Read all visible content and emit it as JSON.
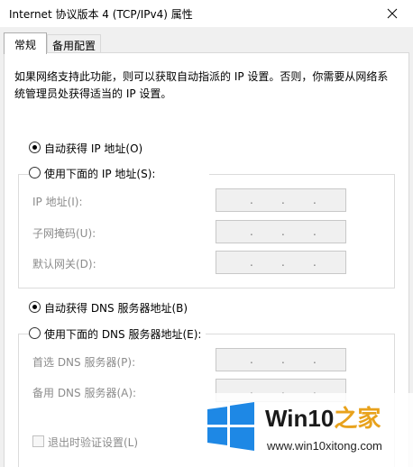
{
  "window": {
    "title": "Internet 协议版本 4 (TCP/IPv4) 属性"
  },
  "tabs": [
    {
      "label": "常规",
      "active": true
    },
    {
      "label": "备用配置",
      "active": false
    }
  ],
  "general": {
    "description": "如果网络支持此功能，则可以获取自动指派的 IP 设置。否则，你需要从网络系统管理员处获得适当的 IP 设置。",
    "ip": {
      "auto_radio_label": "自动获得 IP 地址(O)",
      "auto_checked": true,
      "manual_radio_label": "使用下面的 IP 地址(S):",
      "manual_checked": false,
      "fields": [
        {
          "label": "IP 地址(I):",
          "value": ". . ."
        },
        {
          "label": "子网掩码(U):",
          "value": ". . ."
        },
        {
          "label": "默认网关(D):",
          "value": ". . ."
        }
      ]
    },
    "dns": {
      "auto_radio_label": "自动获得 DNS 服务器地址(B)",
      "auto_checked": true,
      "manual_radio_label": "使用下面的 DNS 服务器地址(E):",
      "manual_checked": false,
      "fields": [
        {
          "label": "首选 DNS 服务器(P):",
          "value": ". . ."
        },
        {
          "label": "备用 DNS 服务器(A):",
          "value": ". . ."
        }
      ]
    },
    "validate_checkbox_label": "退出时验证设置(L)",
    "validate_checked": false
  },
  "watermark": {
    "title_main": "Win10",
    "title_accent": "之家",
    "url": "www.win10xitong.com",
    "logo_color": "#1e88e5"
  },
  "colors": {
    "window_bg": "#f0f0f0",
    "panel_bg": "#ffffff",
    "disabled_text": "#8c8c8c",
    "accent_orange": "#e8a21c"
  },
  "icons": {
    "close": "close-icon",
    "logo": "windows-logo-icon"
  }
}
